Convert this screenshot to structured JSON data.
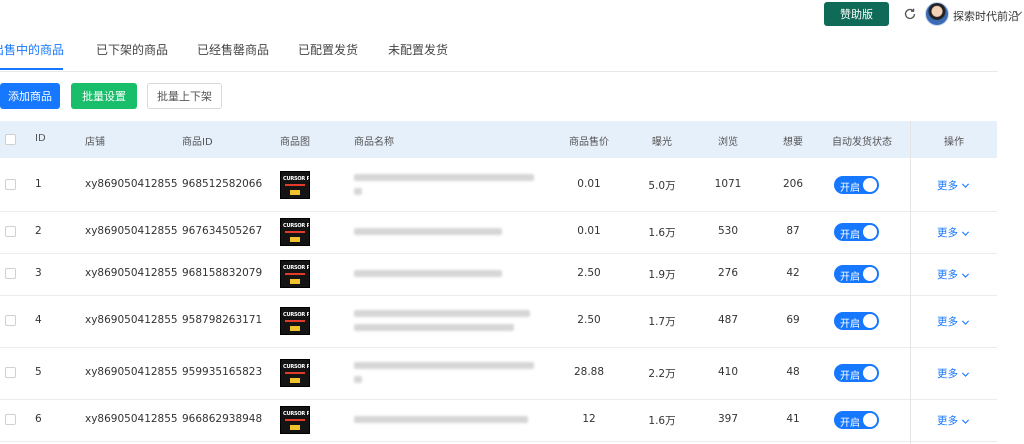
{
  "header": {
    "sponsor_label": "赞助版",
    "user_name": "探索时代前沿"
  },
  "tabs": [
    {
      "label": "出售中的商品"
    },
    {
      "label": "已下架的商品"
    },
    {
      "label": "已经售罄商品"
    },
    {
      "label": "已配置发货"
    },
    {
      "label": "未配置发货"
    }
  ],
  "actions": {
    "add_label": "添加商品",
    "batch_label": "批量设置",
    "toggle_label": "批量上下架"
  },
  "table": {
    "columns": {
      "id": "ID",
      "shop": "店铺",
      "product_id": "商品ID",
      "image": "商品图",
      "name": "商品名称",
      "price": "商品售价",
      "exposure": "曝光",
      "views": "浏览",
      "wants": "想要",
      "auto_ship": "自动发货状态",
      "ops": "操作"
    },
    "thumb_text": "CURSOR PRO",
    "switch_label": "开启",
    "more_label": "更多",
    "rows": [
      {
        "id": "1",
        "shop": "xy869050412855",
        "product_id": "968512582066",
        "price": "0.01",
        "exposure": "5.0万",
        "views": "1071",
        "wants": "206"
      },
      {
        "id": "2",
        "shop": "xy869050412855",
        "product_id": "967634505267",
        "price": "0.01",
        "exposure": "1.6万",
        "views": "530",
        "wants": "87"
      },
      {
        "id": "3",
        "shop": "xy869050412855",
        "product_id": "968158832079",
        "price": "2.50",
        "exposure": "1.9万",
        "views": "276",
        "wants": "42"
      },
      {
        "id": "4",
        "shop": "xy869050412855",
        "product_id": "958798263171",
        "price": "2.50",
        "exposure": "1.7万",
        "views": "487",
        "wants": "69"
      },
      {
        "id": "5",
        "shop": "xy869050412855",
        "product_id": "959935165823",
        "price": "28.88",
        "exposure": "2.2万",
        "views": "410",
        "wants": "48"
      },
      {
        "id": "6",
        "shop": "xy869050412855",
        "product_id": "966862938948",
        "price": "12",
        "exposure": "1.6万",
        "views": "397",
        "wants": "41"
      }
    ]
  }
}
